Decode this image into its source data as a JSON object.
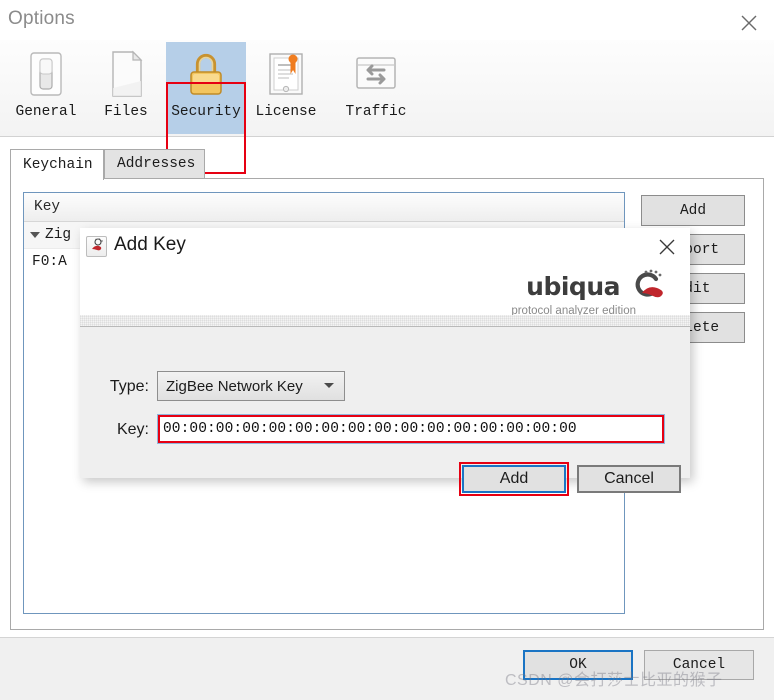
{
  "window": {
    "title": "Options",
    "close_icon": "close-icon"
  },
  "toolbar": {
    "items": [
      {
        "label": "General",
        "icon": "toggle-switch-icon",
        "selected": false
      },
      {
        "label": "Files",
        "icon": "document-page-icon",
        "selected": false
      },
      {
        "label": "Security",
        "icon": "padlock-icon",
        "selected": true
      },
      {
        "label": "License",
        "icon": "certificate-icon",
        "selected": false
      },
      {
        "label": "Traffic",
        "icon": "exchange-arrows-icon",
        "selected": false
      }
    ]
  },
  "tabs": [
    {
      "label": "Keychain",
      "active": true
    },
    {
      "label": "Addresses",
      "active": false
    }
  ],
  "keychain": {
    "column_header": "Key",
    "group_row": "Zig",
    "key_row": "F0:A",
    "buttons": [
      {
        "label": "Add"
      },
      {
        "label": "Import"
      },
      {
        "label": "Edit"
      },
      {
        "label": "Delete"
      }
    ]
  },
  "footer": {
    "ok_label": "OK",
    "cancel_label": "Cancel"
  },
  "watermark": {
    "text": "CSDN @会打莎士比亚的猴子"
  },
  "dialog": {
    "title": "Add Key",
    "icon": "add-key-icon",
    "close_icon": "close-icon",
    "logo": {
      "name": "ubiqua",
      "tagline": "protocol analyzer edition"
    },
    "type_field": {
      "label": "Type:",
      "value": "ZigBee Network Key",
      "options": [
        "ZigBee Network Key"
      ]
    },
    "key_field": {
      "label": "Key:",
      "value": "00:00:00:00:00:00:00:00:00:00:00:00:00:00:00:00",
      "placeholder": "00:00:00:00:00:00:00:00:00:00:00:00:00:00:00:00"
    },
    "add_label": "Add",
    "cancel_label": "Cancel"
  },
  "colors": {
    "selection_blue": "#b6cfe8",
    "annotation_red": "#e60012",
    "focus_blue": "#1a74c4",
    "panel_border_blue": "#6f96bd",
    "logo_red": "#c0262c"
  }
}
